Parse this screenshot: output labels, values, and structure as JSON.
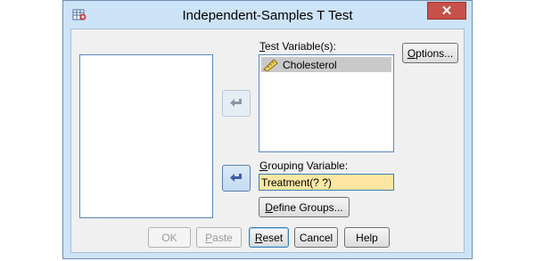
{
  "window": {
    "title": "Independent-Samples T Test",
    "close_icon": "close-icon",
    "app_icon": "spss-dialog-icon"
  },
  "test_variables": {
    "label_prefix": "T",
    "label_rest": "est Variable(s):",
    "items": [
      {
        "icon": "scale-ruler-icon",
        "label": "Cholesterol"
      }
    ]
  },
  "grouping": {
    "label_prefix": "G",
    "label_rest": "rouping Variable:",
    "value": "Treatment(? ?)"
  },
  "buttons": {
    "options_prefix": "O",
    "options_rest": "ptions...",
    "define_groups_prefix": "D",
    "define_groups_rest": "efine Groups...",
    "ok": "OK",
    "paste_prefix": "P",
    "paste_rest": "aste",
    "reset_prefix": "R",
    "reset_rest": "eset",
    "cancel": "Cancel",
    "help": "Help"
  },
  "colors": {
    "window_frame": "#cde3f7",
    "close_button": "#c7504a",
    "grouping_field_bg": "#fde7a3",
    "arrow_active": "#3a5fa8"
  }
}
